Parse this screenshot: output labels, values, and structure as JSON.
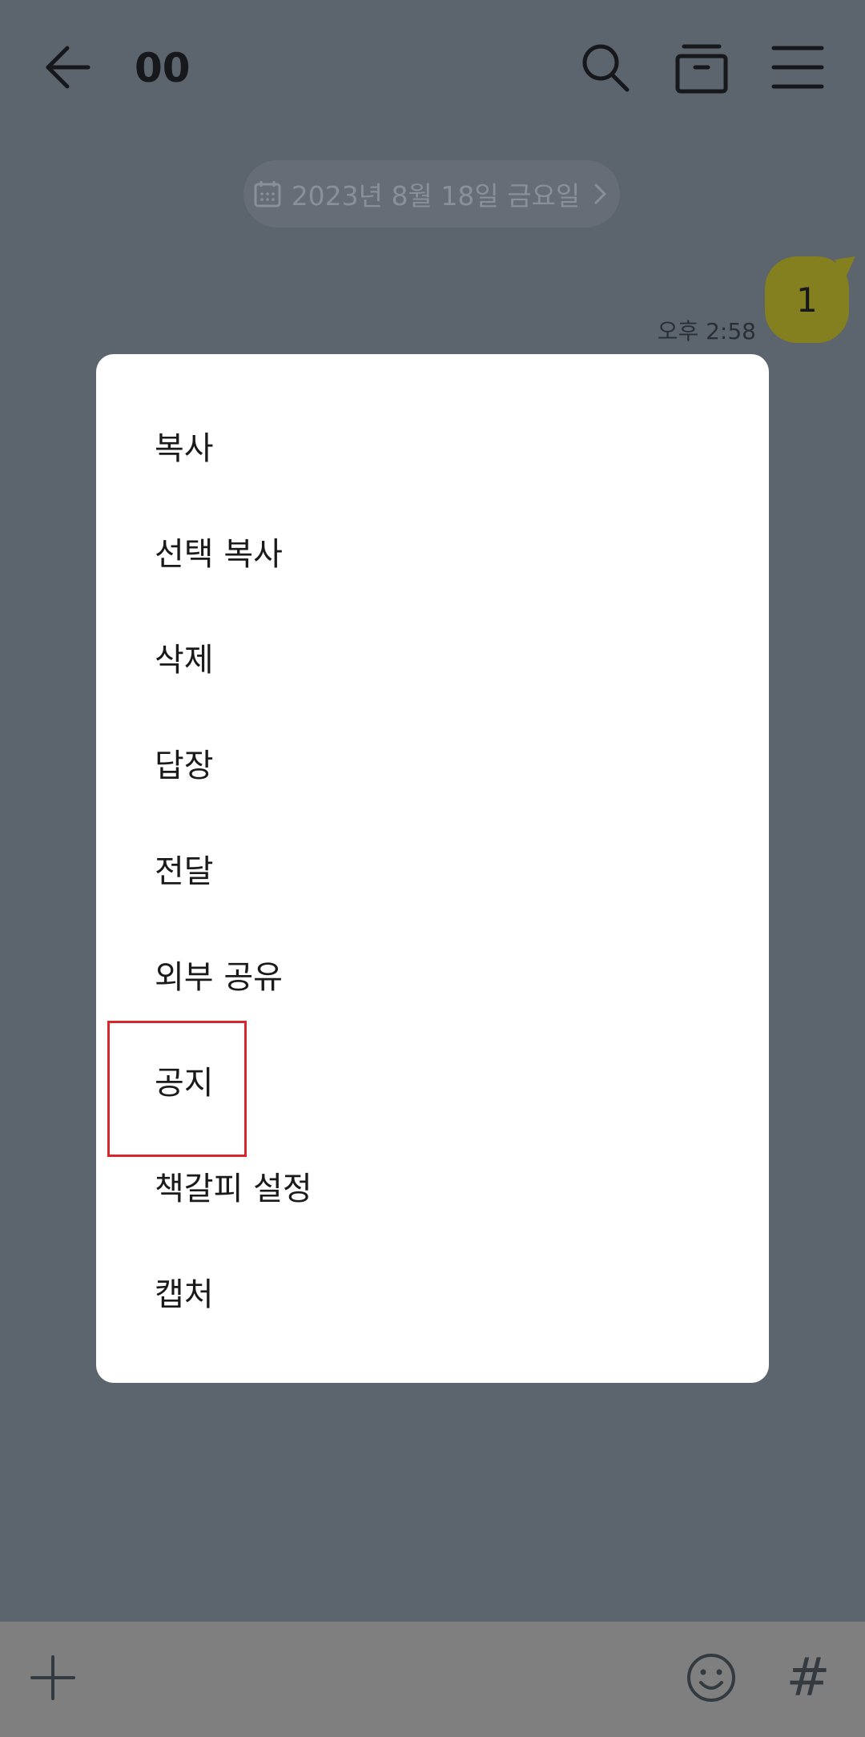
{
  "header": {
    "title": "00",
    "back_icon": "arrow-left-icon",
    "search_icon": "search-icon",
    "archive_icon": "drawer-icon",
    "menu_icon": "hamburger-menu-icon"
  },
  "date_divider": {
    "label": "2023년 8월 18일 금요일",
    "icon": "calendar-icon"
  },
  "message": {
    "text": "1",
    "time": "오후 2:58",
    "bubble_color": "#847f1f"
  },
  "context_menu": {
    "items": [
      {
        "label": "복사"
      },
      {
        "label": "선택 복사"
      },
      {
        "label": "삭제"
      },
      {
        "label": "답장"
      },
      {
        "label": "전달"
      },
      {
        "label": "외부 공유"
      },
      {
        "label": "공지"
      },
      {
        "label": "책갈피 설정"
      },
      {
        "label": "캡처"
      }
    ],
    "highlighted_item": "공지",
    "highlight_color": "#d7262c"
  },
  "bottom_bar": {
    "plus_icon": "plus-icon",
    "emoji_icon": "emoji-icon",
    "hash_label": "#"
  }
}
